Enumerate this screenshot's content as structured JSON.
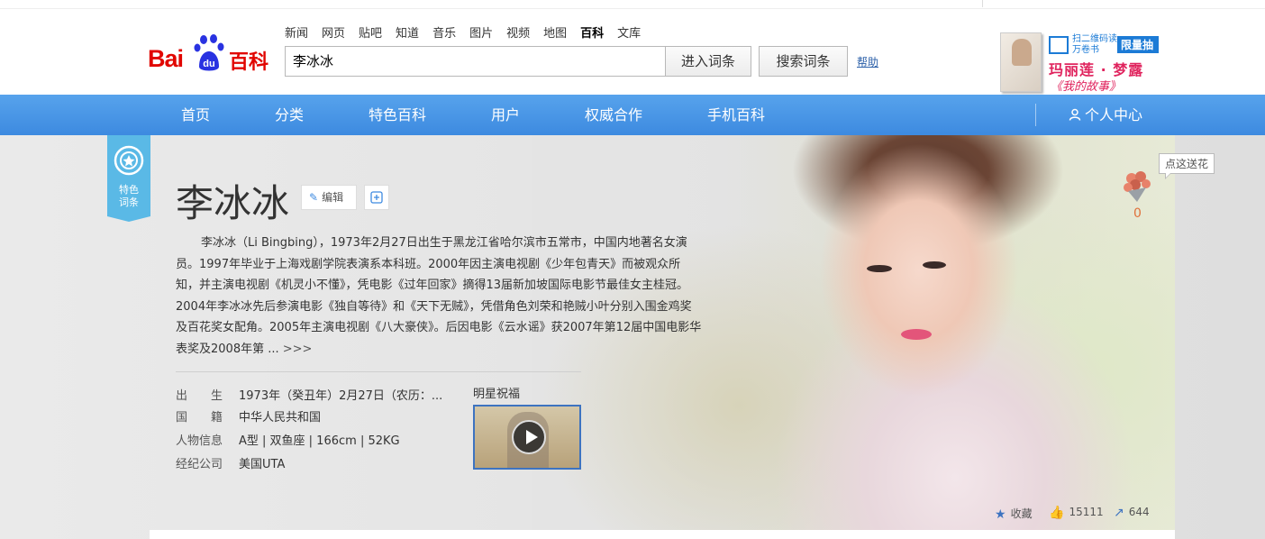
{
  "header": {
    "logo_text": "Bai",
    "logo_du": "du",
    "logo_baike": "百科",
    "nav_links": [
      "新闻",
      "网页",
      "贴吧",
      "知道",
      "音乐",
      "图片",
      "视频",
      "地图",
      "百科",
      "文库"
    ],
    "active_link": "百科",
    "search_value": "李冰冰",
    "enter_button": "进入词条",
    "search_button": "搜索词条",
    "help_link": "帮助"
  },
  "ad": {
    "qr_text": "扫二维码读万卷书",
    "tag": "限量抽",
    "title": "玛丽莲 · 梦露",
    "subtitle": "《我的故事》"
  },
  "navbar": {
    "items": [
      "首页",
      "分类",
      "特色百科",
      "用户",
      "权威合作",
      "手机百科"
    ],
    "user_center": "个人中心"
  },
  "entry": {
    "badge_text": "特色词条",
    "title": "李冰冰",
    "edit_label": "编辑",
    "summary": "李冰冰（Li Bingbing），1973年2月27日出生于黑龙江省哈尔滨市五常市，中国内地著名女演员。1997年毕业于上海戏剧学院表演系本科班。2000年因主演电视剧《少年包青天》而被观众所知，并主演电视剧《机灵小不懂》，凭电影《过年回家》摘得13届新加坡国际电影节最佳女主桂冠。2004年李冰冰先后参演电影《独自等待》和《天下无贼》，凭借角色刘荣和艳贼小叶分别入围金鸡奖及百花奖女配角。2005年主演电视剧《八大豪侠》。后因电影《云水谣》获2007年第12届中国电影华表奖及2008年第 ...",
    "more": ">>>",
    "facts": [
      {
        "label": "出　　生",
        "value": "1973年（癸丑年）2月27日（农历：..."
      },
      {
        "label": "国　　籍",
        "value": "中华人民共和国"
      },
      {
        "label": "人物信息",
        "value": "A型 | 双鱼座 | 166cm | 52KG"
      },
      {
        "label": "经纪公司",
        "value": "美国UTA"
      }
    ],
    "star_blessing": "明星祝福",
    "flower_tip": "点这送花",
    "flower_count": "0",
    "collect": "收藏",
    "likes": "15111",
    "shares": "644"
  },
  "colors": {
    "brand_red": "#e10601",
    "nav_blue": "#3d8ae0",
    "link_blue": "#2b5fa8",
    "ad_pink": "#e0245e"
  }
}
